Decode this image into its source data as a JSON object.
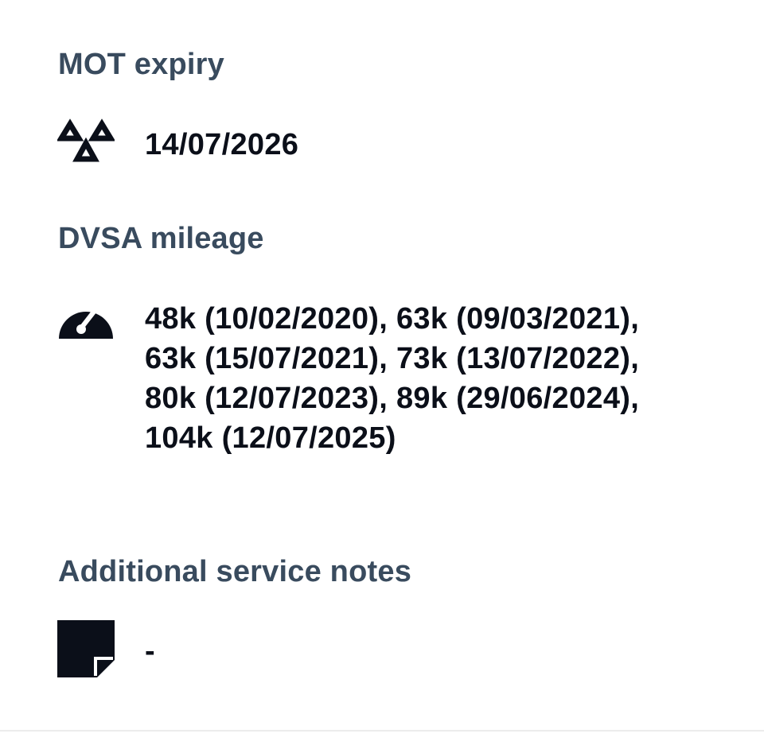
{
  "sections": {
    "mot": {
      "heading": "MOT expiry",
      "icon": "mot-triangles-icon",
      "value": "14/07/2026"
    },
    "mileage": {
      "heading": "DVSA mileage",
      "icon": "speedometer-icon",
      "value": "48k (10/02/2020), 63k (09/03/2021), 63k (15/07/2021), 73k (13/07/2022), 80k (12/07/2023), 89k (29/06/2024), 104k (12/07/2025)"
    },
    "notes": {
      "heading": "Additional service notes",
      "icon": "note-icon",
      "value": "-"
    }
  },
  "colors": {
    "heading": "#394b5e",
    "text": "#0b0f19",
    "divider": "#ececec"
  }
}
